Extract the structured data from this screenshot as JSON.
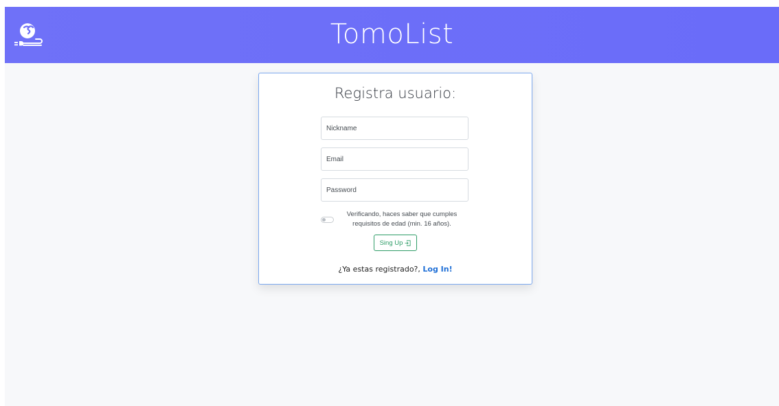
{
  "header": {
    "brand": "TomoList",
    "logo_icon": "tomolist-logo-icon",
    "background": "#6c6ef9"
  },
  "register_card": {
    "title": "Registra usuario:",
    "fields": {
      "nickname_placeholder": "Nickname",
      "email_placeholder": "Email",
      "password_placeholder": "Password"
    },
    "age_toggle": {
      "checked": false,
      "label": "Verificando, haces saber que cumples requisitos de edad (min. 16 años)."
    },
    "signup_button": {
      "label": "Sing Up",
      "icon": "box-arrow-in-right-icon",
      "color": "#2e9c67"
    },
    "login_prompt": {
      "text": "¿Ya estas registrado?, ",
      "link_label": "Log In!",
      "link_color": "#1f6fd6"
    }
  }
}
